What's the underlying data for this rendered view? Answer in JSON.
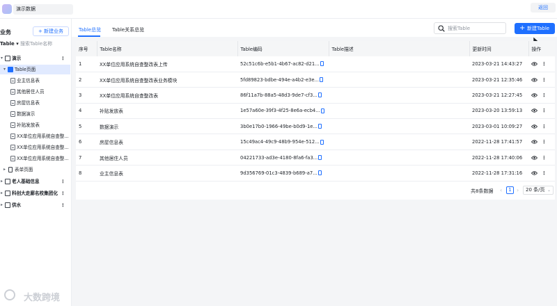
{
  "app": {
    "title": "演示数据",
    "back_label": "返回"
  },
  "sidebar": {
    "heading": "业务",
    "new_business_label": "+ 新建业务",
    "filter_select": "Table",
    "search_placeholder": "搜索Table名称",
    "tree": [
      {
        "label": "演示"
      },
      {
        "label": "Table页面"
      },
      {
        "label": "业主信息表"
      },
      {
        "label": "其他居住人员"
      },
      {
        "label": "房屋信息表"
      },
      {
        "label": "数据演示"
      },
      {
        "label": "补贴发放表"
      },
      {
        "label": "XX单位应用系统自查整..."
      },
      {
        "label": "XX单位应用系统自查整..."
      },
      {
        "label": "XX单位应用系统自查整..."
      },
      {
        "label": "表单页面"
      },
      {
        "label": "老人基础信息"
      },
      {
        "label": "科创大走廊名校集团化"
      },
      {
        "label": "供水"
      }
    ]
  },
  "tabs": [
    {
      "label": "Table总览",
      "active": true
    },
    {
      "label": "Table关系总览",
      "active": false
    }
  ],
  "search": {
    "placeholder": "搜索Table",
    "value": ""
  },
  "new_table_label": "新建Table",
  "table": {
    "columns": [
      "序号",
      "Table名称",
      "Table编码",
      "Table描述",
      "更新时间",
      "操作"
    ],
    "rows": [
      {
        "index": "1",
        "name": "XX单位应用系统自查整改表上传",
        "code": "52c51c6b-e5b1-4b67-ac82-d21...",
        "desc": "",
        "updated": "2023-03-21 14:43:27"
      },
      {
        "index": "2",
        "name": "XX单位应用系统自查整改表业务模块",
        "code": "5fd89823-bdbe-494e-a4b2-e3e...",
        "desc": "",
        "updated": "2023-03-21 12:35:46"
      },
      {
        "index": "3",
        "name": "XX单位应用系统自查整改表",
        "code": "86f11a7b-88a5-48d3-9de7-cf3...",
        "desc": "",
        "updated": "2023-03-21 12:27:45"
      },
      {
        "index": "4",
        "name": "补贴发放表",
        "code": "1e57a60e-39f3-4f25-8e6a-ecb4...",
        "desc": "",
        "updated": "2023-03-20 13:59:13"
      },
      {
        "index": "5",
        "name": "数据演示",
        "code": "3b0e17b0-1966-49be-b0d9-1e...",
        "desc": "",
        "updated": "2023-03-01 10:09:27"
      },
      {
        "index": "6",
        "name": "房屋信息表",
        "code": "15c49ac4-49c9-48b9-954e-512...",
        "desc": "",
        "updated": "2022-11-28 17:41:57"
      },
      {
        "index": "7",
        "name": "其他居住人员",
        "code": "04221733-ad3e-4180-8fa6-fa3...",
        "desc": "",
        "updated": "2022-11-28 17:40:06"
      },
      {
        "index": "8",
        "name": "业主信息表",
        "code": "9d356769-01c3-4839-b689-a7...",
        "desc": "",
        "updated": "2022-11-28 17:31:16"
      }
    ]
  },
  "pagination": {
    "total_label": "共8条数据",
    "current_page": "1",
    "page_size": "20 条/页"
  },
  "watermark": "大数跨境",
  "colors": {
    "accent": "#1e6fff",
    "selected_bg": "#e1eaff",
    "canvas_bg": "#f4f5f7"
  }
}
